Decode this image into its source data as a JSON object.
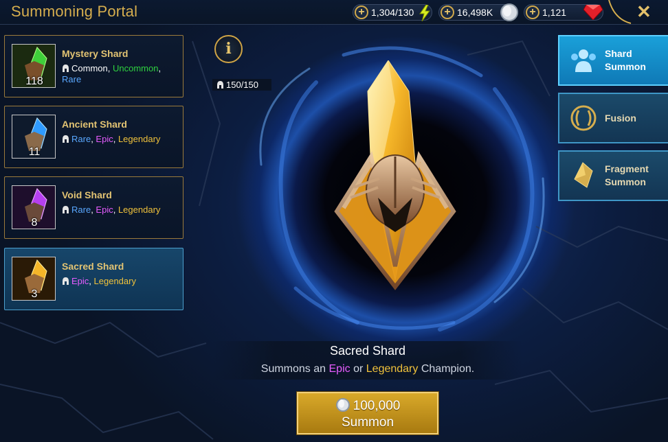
{
  "header": {
    "title": "Summoning Portal",
    "energy": "1,304/130",
    "silver": "16,498K",
    "gems": "1,121"
  },
  "shards": [
    {
      "name": "Mystery Shard",
      "count": "118",
      "rarities": [
        "Common",
        "Uncommon",
        "Rare"
      ],
      "selected": false
    },
    {
      "name": "Ancient Shard",
      "count": "11",
      "rarities": [
        "Rare",
        "Epic",
        "Legendary"
      ],
      "selected": false
    },
    {
      "name": "Void Shard",
      "count": "8",
      "rarities": [
        "Rare",
        "Epic",
        "Legendary"
      ],
      "selected": false
    },
    {
      "name": "Sacred Shard",
      "count": "3",
      "rarities": [
        "Epic",
        "Legendary"
      ],
      "selected": true
    }
  ],
  "champions_owned": "150/150",
  "info_label": "i",
  "menu": {
    "shard_summon": "Shard\nSummon",
    "shard_summon_1": "Shard",
    "shard_summon_2": "Summon",
    "fusion": "Fusion",
    "fragment_summon_1": "Fragment",
    "fragment_summon_2": "Summon"
  },
  "selected_shard": {
    "title": "Sacred Shard",
    "desc_prefix": "Summons an",
    "desc_epic": "Epic",
    "desc_or": "or",
    "desc_legendary": "Legendary",
    "desc_suffix": "Champion."
  },
  "summon": {
    "cost": "100,000",
    "label": "Summon"
  },
  "colors": {
    "gold": "#d6ae4e",
    "uncommon": "#2fd23f",
    "rare": "#5aa8ff",
    "epic": "#e75cff",
    "legendary": "#f0c23b",
    "active_menu": "#1aa0d9"
  },
  "icons": [
    "plus-icon",
    "lightning-icon",
    "silver-coin-icon",
    "ruby-gem-icon",
    "close-icon",
    "helmet-icon",
    "info-icon",
    "shard-summon-icon",
    "fusion-icon",
    "fragment-summon-icon"
  ]
}
